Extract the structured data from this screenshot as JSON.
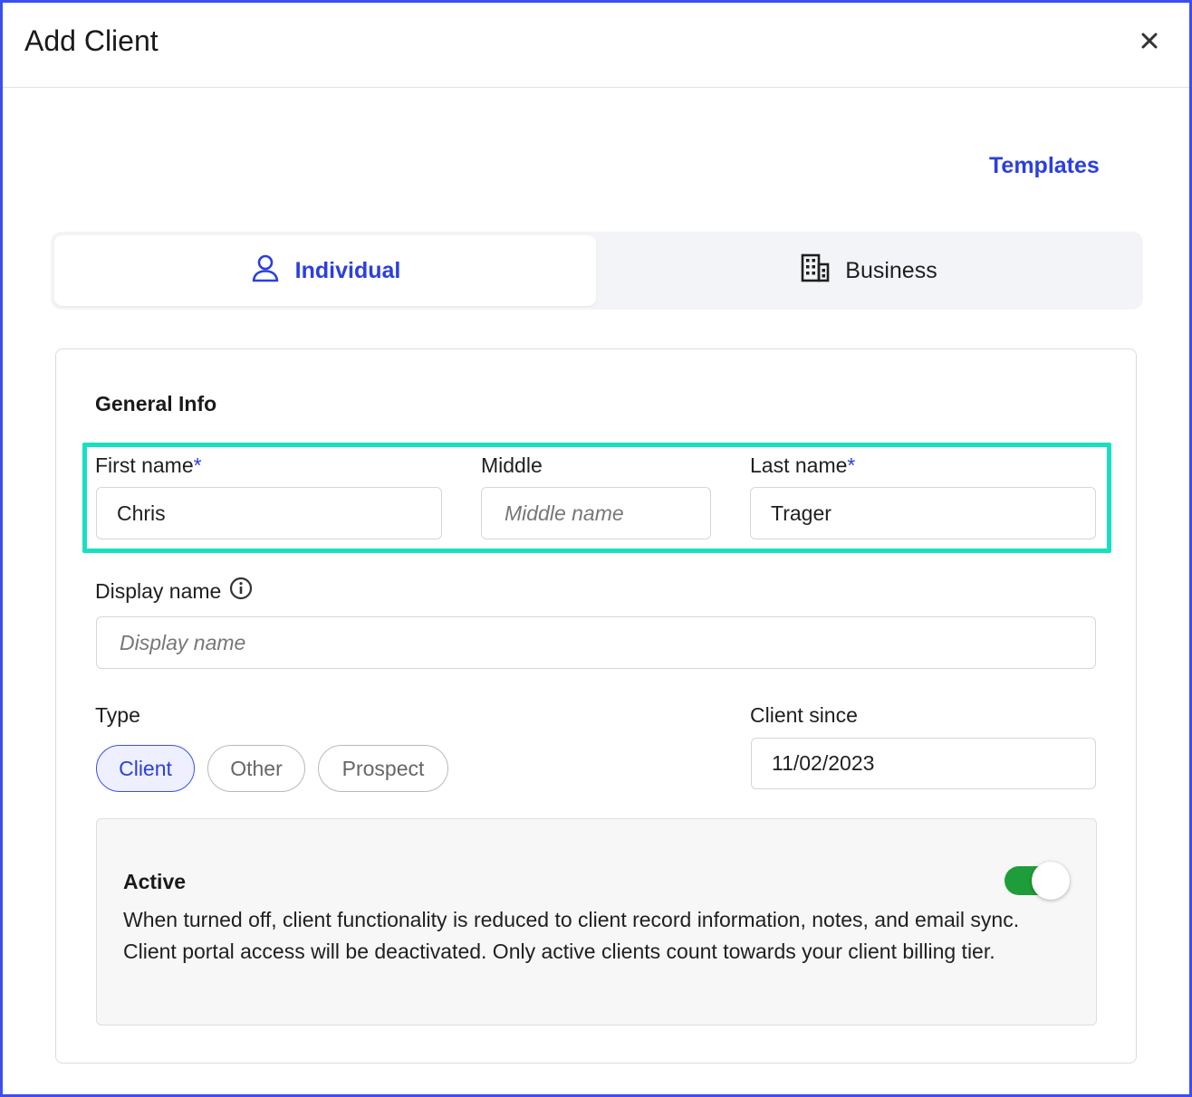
{
  "dialog": {
    "title": "Add Client",
    "close_icon": "close-icon",
    "templates_link": "Templates"
  },
  "client_kind_tabs": [
    {
      "label": "Individual",
      "icon": "person-icon",
      "selected": true
    },
    {
      "label": "Business",
      "icon": "building-icon",
      "selected": false
    }
  ],
  "general_info": {
    "section_title": "General Info",
    "required_marker": "*",
    "first_name": {
      "label": "First name",
      "value": "Chris"
    },
    "middle_name": {
      "label": "Middle",
      "placeholder": "Middle name",
      "value": ""
    },
    "last_name": {
      "label": "Last name",
      "value": "Trager"
    },
    "display_name": {
      "label": "Display name",
      "placeholder": "Display name",
      "value": "",
      "info_icon": "info-icon"
    },
    "type": {
      "label": "Type",
      "options": [
        {
          "label": "Client",
          "selected": true
        },
        {
          "label": "Other",
          "selected": false
        },
        {
          "label": "Prospect",
          "selected": false
        }
      ]
    },
    "client_since": {
      "label": "Client since",
      "value": "11/02/2023"
    },
    "active": {
      "title": "Active",
      "enabled": true,
      "description": "When turned off, client functionality is reduced to client record information, notes, and email sync. Client portal access will be deactivated. Only active clients count towards your client billing tier."
    }
  },
  "colors": {
    "accent": "#2a3fe0",
    "highlight": "#17e0c0",
    "toggle_on": "#1e9e3a",
    "frame_border": "#3a4ff0"
  }
}
